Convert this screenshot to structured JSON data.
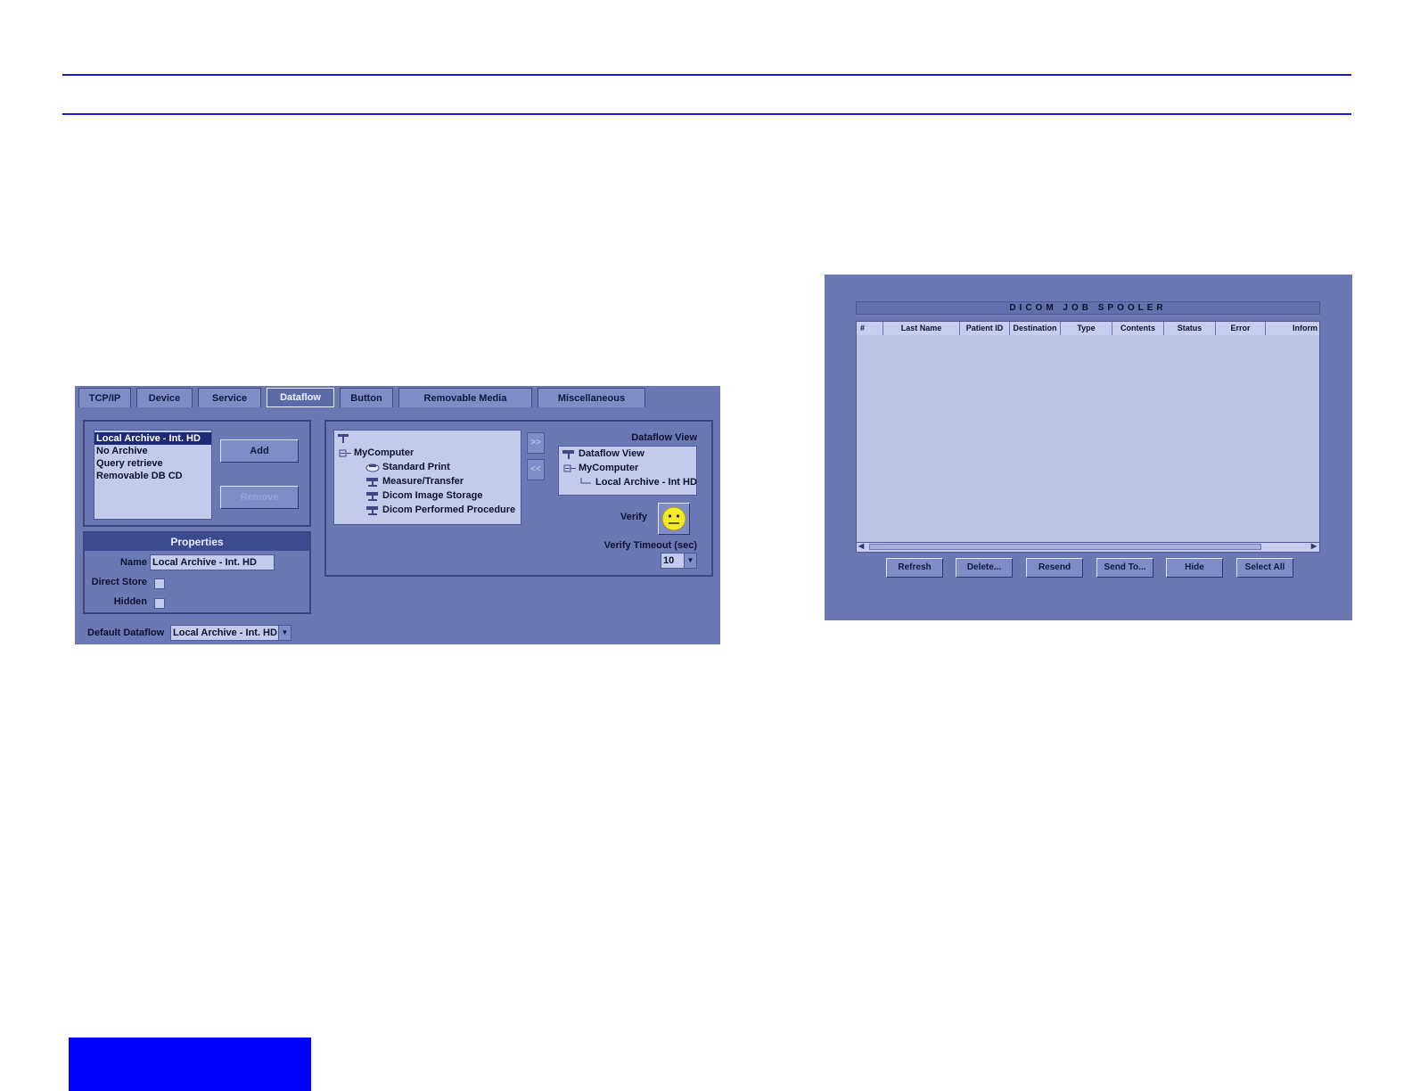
{
  "config": {
    "tabs": [
      "TCP/IP",
      "Device",
      "Service",
      "Dataflow",
      "Button",
      "Removable Media",
      "Miscellaneous"
    ],
    "active_tab": "Dataflow",
    "dataflow_list": [
      "Local Archive - Int. HD",
      "No Archive",
      "Query retrieve",
      "Removable DB CD"
    ],
    "selected_dataflow": "Local Archive - Int. HD",
    "add_label": "Add",
    "remove_label": "Remove",
    "properties": {
      "header": "Properties",
      "name_label": "Name",
      "name_value": "Local Archive - Int. HD",
      "direct_store_label": "Direct Store",
      "hidden_label": "Hidden"
    },
    "default_dataflow_label": "Default Dataflow",
    "default_dataflow_value": "Local Archive - Int. HD",
    "device_tree": {
      "root": "MyComputer",
      "children": [
        "Standard Print",
        "Measure/Transfer",
        "Dicom Image Storage",
        "Dicom Performed Procedure"
      ]
    },
    "move_right_label": ">>",
    "move_left_label": "<<",
    "dataflow_view_label": "Dataflow View",
    "dataflow_view_tree": {
      "root": "Dataflow View",
      "computer": "MyComputer",
      "leaf": "Local Archive - Int HD"
    },
    "verify_label": "Verify",
    "verify_timeout_label": "Verify Timeout (sec)",
    "verify_timeout_value": "10"
  },
  "spooler": {
    "title": "DICOM JOB SPOOLER",
    "columns": [
      "#",
      "Last Name",
      "Patient ID",
      "Destination",
      "Type",
      "Contents",
      "Status",
      "Error",
      "Inform"
    ],
    "rows": [],
    "buttons": [
      "Refresh",
      "Delete...",
      "Resend",
      "Send To...",
      "Hide",
      "Select All"
    ]
  },
  "colors": {
    "rule_blue": "#1a1ad8",
    "block_blue": "#0000ff",
    "panel_bg": "#6b78b4",
    "list_bg": "#c3cbec",
    "selection": "#1e2a78",
    "smiley_yellow": "#f4ea28"
  }
}
